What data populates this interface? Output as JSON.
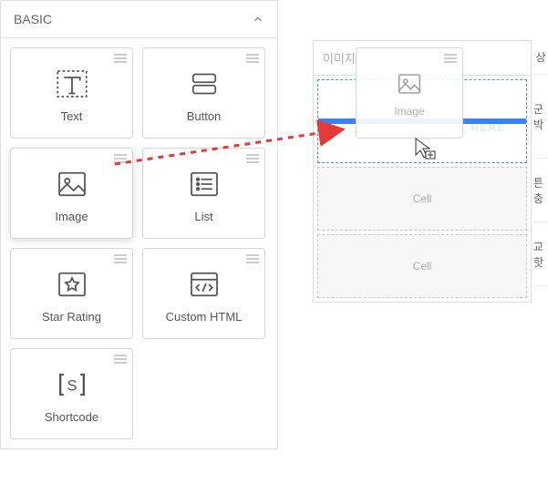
{
  "panel": {
    "header": "BASIC",
    "widgets": [
      {
        "name": "text",
        "label": "Text"
      },
      {
        "name": "button",
        "label": "Button"
      },
      {
        "name": "image",
        "label": "Image"
      },
      {
        "name": "list",
        "label": "List"
      },
      {
        "name": "star-rating",
        "label": "Star Rating"
      },
      {
        "name": "custom-html",
        "label": "Custom HTML"
      },
      {
        "name": "shortcode",
        "label": "Shortcode"
      }
    ]
  },
  "canvas": {
    "header": "이미지",
    "drop_hint": "HERE",
    "ghost_label": "Image",
    "cells": [
      "Cell",
      "Cell"
    ],
    "side_labels": [
      "상",
      "군박",
      "튼충",
      "교핫"
    ]
  }
}
